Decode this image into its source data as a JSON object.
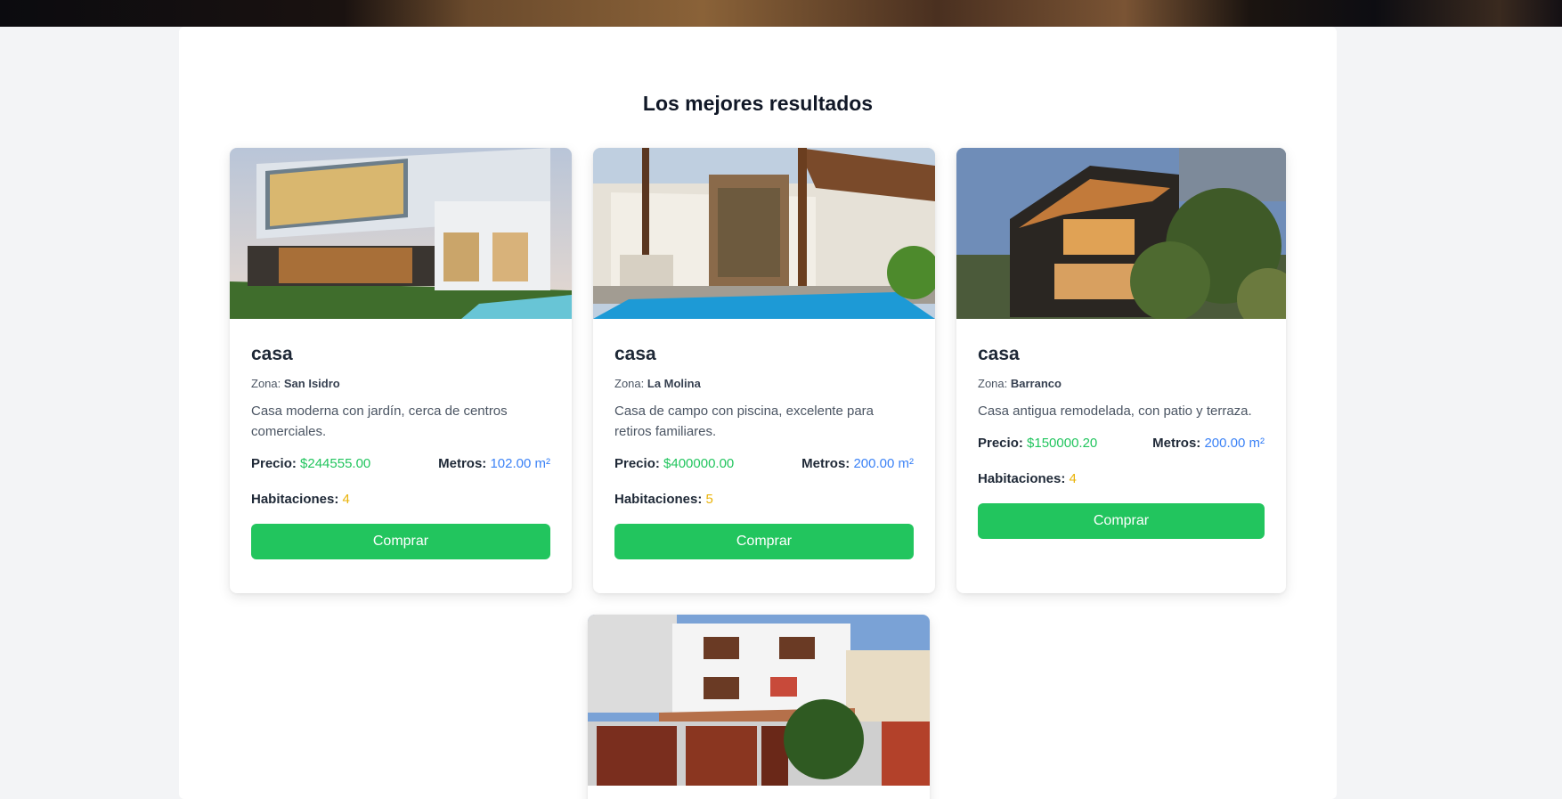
{
  "section": {
    "title": "Los mejores resultados"
  },
  "labels": {
    "zone": "Zona:",
    "price": "Precio:",
    "meters": "Metros:",
    "rooms": "Habitaciones:",
    "buy": "Comprar"
  },
  "colors": {
    "accent_green": "#22c55e",
    "meters_blue": "#3b82f6",
    "rooms_yellow": "#eab308",
    "page_bg": "#f3f4f6"
  },
  "listings": [
    {
      "title": "casa",
      "zone": "San Isidro",
      "description": "Casa moderna con jardín, cerca de centros comerciales.",
      "price": "$244555.00",
      "meters": "102.00 m²",
      "rooms": "4",
      "image": "modern-glass-house-photo"
    },
    {
      "title": "casa",
      "zone": "La Molina",
      "description": "Casa de campo con piscina, excelente para retiros familiares.",
      "price": "$400000.00",
      "meters": "200.00 m²",
      "rooms": "5",
      "image": "house-with-pool-photo"
    },
    {
      "title": "casa",
      "zone": "Barranco",
      "description": "Casa antigua remodelada, con patio y terraza.",
      "price": "$150000.20",
      "meters": "200.00 m²",
      "rooms": "4",
      "image": "hillside-modern-house-photo"
    },
    {
      "image": "white-townhouse-with-garage-photo"
    }
  ]
}
